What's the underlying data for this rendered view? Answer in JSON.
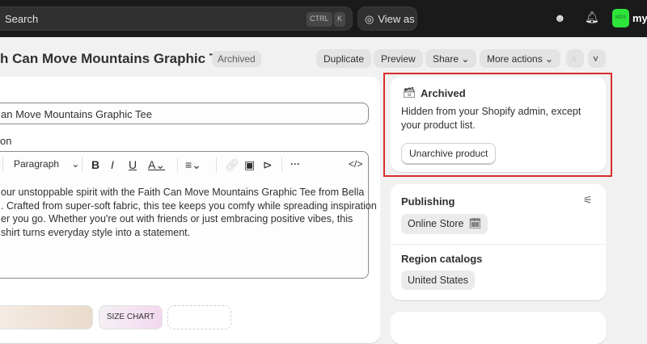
{
  "topbar": {
    "search_placeholder": "Search",
    "kbd1": "CTRL",
    "kbd2": "K",
    "view_as": "View as",
    "avatar_initials": "MDS",
    "store_name": "my"
  },
  "header": {
    "title": "h Can Move Mountains Graphic Tee",
    "status": "Archived",
    "actions": {
      "duplicate": "Duplicate",
      "preview": "Preview",
      "share": "Share",
      "more": "More actions"
    }
  },
  "form": {
    "title_value": "an Move Mountains Graphic Tee",
    "description_label": "on",
    "toolbar": {
      "paragraph": "Paragraph"
    },
    "description_lines": [
      "our unstoppable spirit with the Faith Can Move Mountains Graphic Tee from Bella",
      ". Crafted from super-soft fabric, this tee keeps you comfy while spreading inspiration",
      "er you go. Whether you're out with friends or just embracing positive vibes, this",
      "shirt turns everyday style into a statement."
    ],
    "media": {
      "size_chart": "SIZE CHART"
    }
  },
  "archived_card": {
    "title": "Archived",
    "text": "Hidden from your Shopify admin, except your product list.",
    "button": "Unarchive product",
    "highlight_color": "#d82c2c"
  },
  "publishing": {
    "title": "Publishing",
    "channel": "Online Store",
    "region_title": "Region catalogs",
    "region": "United States"
  }
}
